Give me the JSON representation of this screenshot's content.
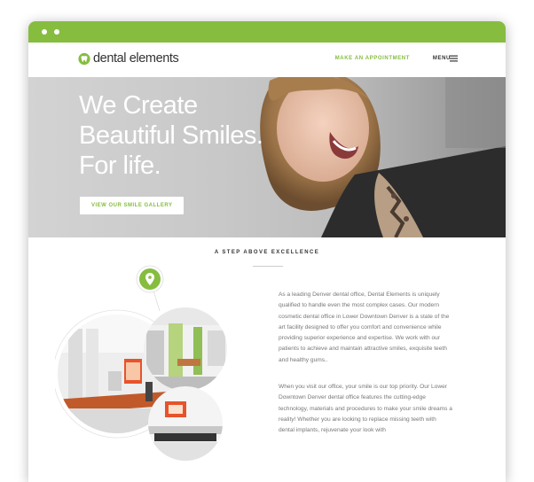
{
  "brand": {
    "name": "dental elements",
    "accent": "#86bd3f"
  },
  "nav": {
    "cta": "MAKE AN APPOINTMENT",
    "menu": "MENU"
  },
  "hero": {
    "line1": "We Create",
    "line2": "Beautiful Smiles.",
    "line3": "For life.",
    "button": "VIEW OUR SMILE GALLERY"
  },
  "about": {
    "tagline": "A STEP ABOVE EXCELLENCE",
    "paragraph1": "As a leading Denver dental office, Dental Elements is uniquely qualified to handle even the most complex cases. Our modern cosmetic dental office in Lower Downtown Denver is a state of the art facility designed to offer you comfort and convenience while providing superior experience and expertise. We work with our patients to achieve and maintain attractive smiles, exquisite teeth and healthy gums..",
    "paragraph2": "When you visit our office, your smile is our top priority. Our Lower Downtown Denver dental office features the cutting-edge technology, materials and procedures to make your smile dreams a reality! Whether you are looking to replace missing teeth with dental implants, rejuvenate your look with"
  },
  "icons": [
    "tooth-logo-icon",
    "menu-hamburger-icon",
    "location-pin-icon"
  ]
}
